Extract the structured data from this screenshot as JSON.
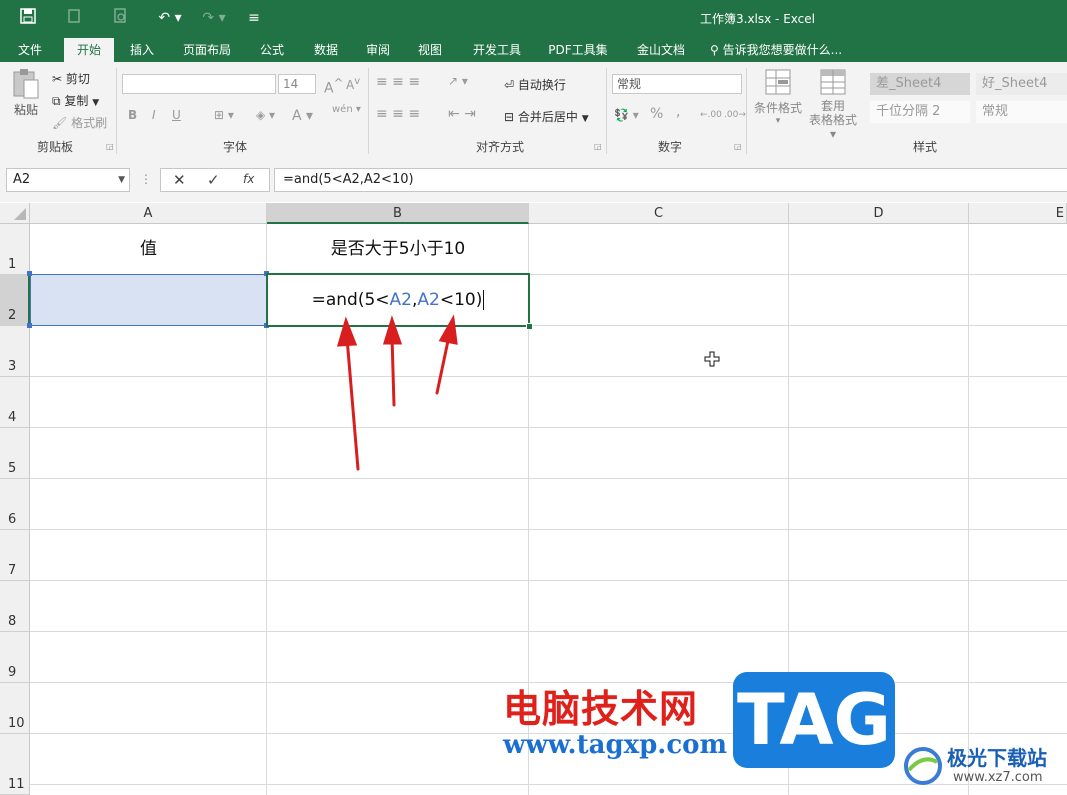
{
  "window": {
    "title": "工作簿3.xlsx - Excel"
  },
  "ribbon_tabs": [
    "文件",
    "开始",
    "插入",
    "页面布局",
    "公式",
    "数据",
    "审阅",
    "视图",
    "开发工具",
    "PDF工具集",
    "金山文档"
  ],
  "tell_me": "告诉我您想要做什么...",
  "clipboard": {
    "paste": "粘贴",
    "cut": "剪切",
    "copy": "复制",
    "format_painter": "格式刷",
    "label": "剪贴板"
  },
  "font": {
    "name": "",
    "size": "14",
    "bold": "B",
    "italic": "I",
    "underline": "U",
    "font_color": "A",
    "phonetic": "wén",
    "label": "字体"
  },
  "alignment": {
    "wrap_text": "自动换行",
    "merge_center": "合并后居中",
    "label": "对齐方式"
  },
  "number": {
    "format": "常规",
    "percent": "%",
    "comma": ",",
    "inc_decimal": ".00",
    "dec_decimal": ".00",
    "label": "数字"
  },
  "styles": {
    "conditional": "条件格式",
    "table": [
      "套用",
      "表格格式"
    ],
    "tiles": [
      "差_Sheet4",
      "好_Sheet4",
      "千位分隔 2",
      "常规"
    ],
    "label": "样式"
  },
  "formula_bar": {
    "name_box": "A2",
    "fx": "fx",
    "formula": "=and(5<A2,A2<10)"
  },
  "columns": [
    "A",
    "B",
    "C",
    "D",
    "E"
  ],
  "rows": [
    "1",
    "2",
    "3",
    "4",
    "5",
    "6",
    "7",
    "8",
    "9",
    "10",
    "11"
  ],
  "cells": {
    "A1": "值",
    "B1": "是否大于5小于10",
    "B2": {
      "part1": "=and(5<",
      "ref1": "A2",
      "comma": ",",
      "ref2": "A2",
      "part2": "<10)"
    }
  },
  "colors": {
    "excel_green": "#217346",
    "ref_blue": "#4472c4",
    "selection_fill": "#d9e2f3",
    "arrow_red": "#d81e1e"
  },
  "watermark": {
    "cn": "电脑技术网",
    "tag": "TAG",
    "url": "www.tagxp.com",
    "site": "极光下载站",
    "site_url": "www.xz7.com"
  }
}
